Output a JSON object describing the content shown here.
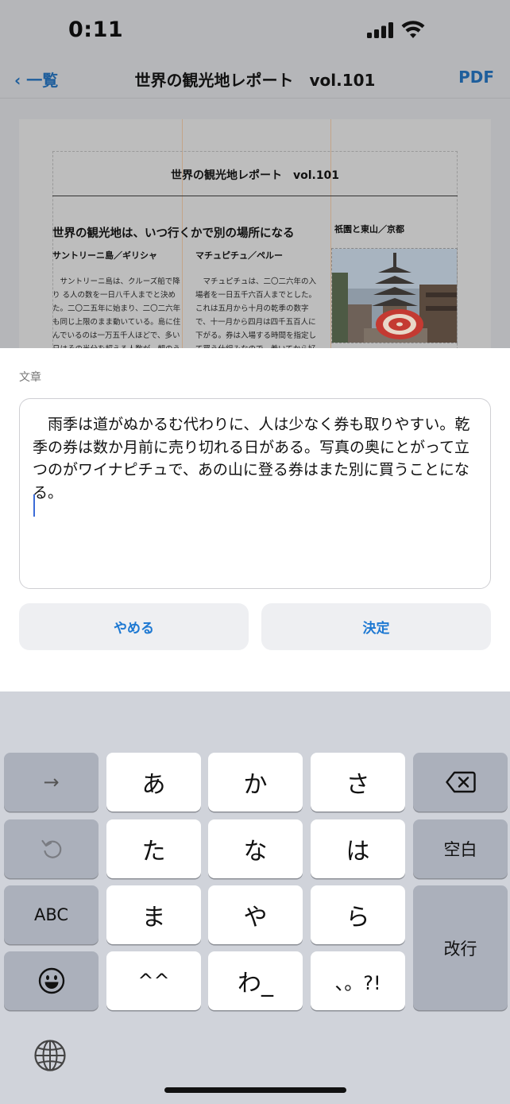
{
  "status_bar": {
    "time": "0:11"
  },
  "nav": {
    "back_label": "‹ 一覧",
    "title": "世界の観光地レポート　vol.101",
    "pdf_label": "PDF"
  },
  "document": {
    "title": "世界の観光地レポート　vol.101",
    "headline": "世界の観光地は、いつ行くかで別の場所になる",
    "side_head": "祇園と東山／京都",
    "col1_head": "サントリーニ島／ギリシャ",
    "col2_head": "マチュピチュ／ペルー",
    "col1_text": "　サントリーニ島は、クルーズ船で降り る人の数を一日八千人までと決め た。二〇二五年に始まり、二〇二六年 も同じ上限のまま動いている。島に住 んでいるのは一万五千人ほどで、多い 日はその半分を超える人数が、朝のう",
    "col2_text": "　マチュピチュは、二〇二六年の入 場者を一日五千六百人までとした。 これは五月から十月の乾季の数字 で、十一月から四月は四千五百人に 下がる。券は入場する時間を指定し て買う仕組みなので、着いてから好"
  },
  "editor": {
    "label": "文章",
    "text": "　雨季は道がぬかるむ代わりに、人は少なく券も取りやすい。乾季の券は数か月前に売り切れる日がある。写真の奥にとがって立つのがワイナピチュで、あの山に登る券はまた別に買うことになる。",
    "cancel_label": "やめる",
    "confirm_label": "決定",
    "accent_color": "#1d78d2"
  },
  "keyboard": {
    "arrow": "→",
    "undo_icon": "undo-icon",
    "abc": "ABC",
    "emoji_icon": "emoji-icon",
    "keys": [
      "あ",
      "か",
      "さ",
      "た",
      "な",
      "は",
      "ま",
      "や",
      "ら",
      "^^",
      "わ_",
      "、。?!"
    ],
    "backspace_icon": "backspace-icon",
    "space": "空白",
    "return": "改行",
    "globe_icon": "globe-icon"
  }
}
